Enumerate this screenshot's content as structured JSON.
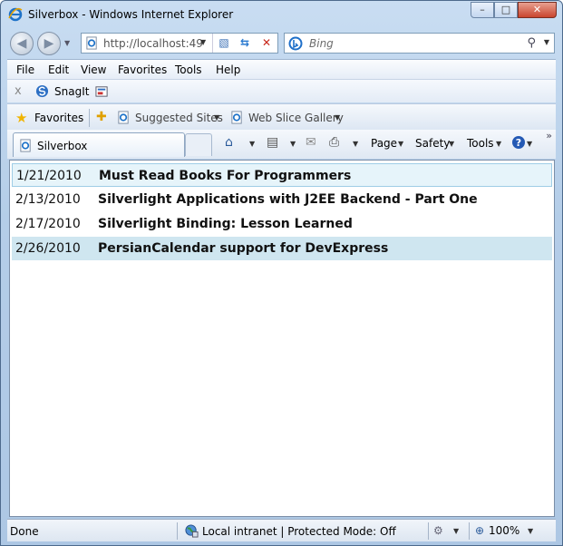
{
  "window": {
    "title": "Silverbox - Windows Internet Explorer",
    "minimize": "–",
    "maximize": "□",
    "close": "✕"
  },
  "nav": {
    "back": "◀",
    "forward": "▶",
    "address": "http://localhost:49",
    "search_placeholder": "Bing"
  },
  "menu": {
    "items": [
      "File",
      "Edit",
      "View",
      "Favorites",
      "Tools",
      "Help"
    ]
  },
  "snagit": {
    "close": "x",
    "label": "SnagIt"
  },
  "favorites_bar": {
    "favorites_label": "Favorites",
    "suggested_sites": "Suggested Sites",
    "web_slice_gallery": "Web Slice Gallery"
  },
  "tab": {
    "label": "Silverbox"
  },
  "commands": {
    "page": "Page",
    "safety": "Safety",
    "tools": "Tools"
  },
  "posts": [
    {
      "date": "1/21/2010",
      "title": "Must Read Books For Programmers"
    },
    {
      "date": "2/13/2010",
      "title": "Silverlight Applications with J2EE Backend - Part One"
    },
    {
      "date": "2/17/2010",
      "title": "Silverlight Binding: Lesson Learned"
    },
    {
      "date": "2/26/2010",
      "title": "PersianCalendar support for DevExpress"
    }
  ],
  "status": {
    "text": "Done",
    "zone": "Local intranet | Protected Mode: Off",
    "zoom": "100%"
  }
}
